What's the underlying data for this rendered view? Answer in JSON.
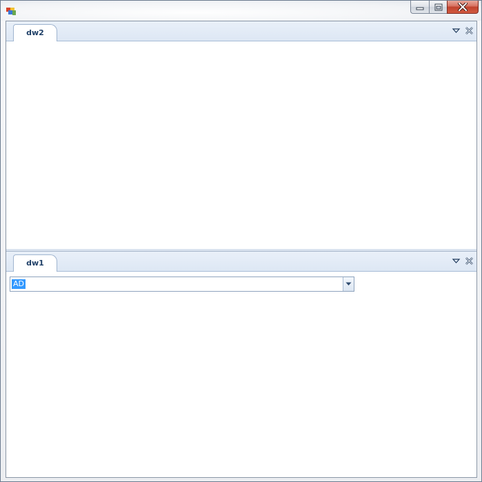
{
  "window": {
    "title": "",
    "buttons": {
      "minimize": "minimize-icon",
      "maximize": "restore-icon",
      "close": "close-icon"
    }
  },
  "panels": {
    "top": {
      "tab_label": "dw2",
      "tools": [
        "dropdown-arrow-icon",
        "close-panel-icon"
      ]
    },
    "bottom": {
      "tab_label": "dw1",
      "tools": [
        "dropdown-arrow-icon",
        "close-panel-icon"
      ],
      "combo": {
        "value": "AD"
      }
    }
  },
  "colors": {
    "selection": "#3399ff",
    "tab_text": "#1e3f67",
    "tabstrip": "#e3ebf6",
    "close_button": "#c0432e"
  }
}
